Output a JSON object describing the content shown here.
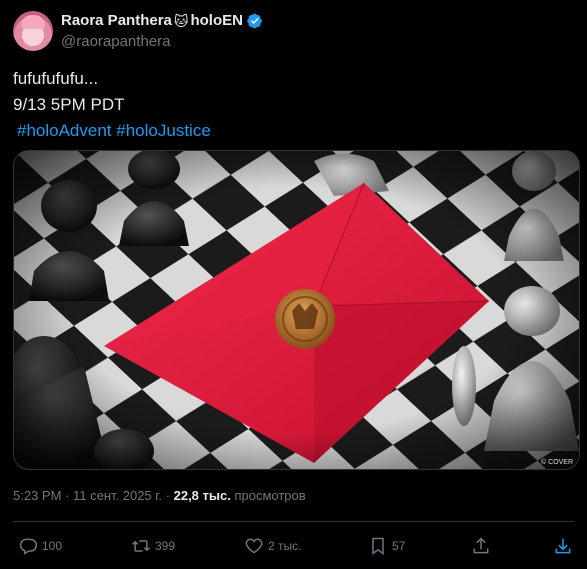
{
  "author": {
    "display_name": "Raora Panthera",
    "cat_emoji": "🐱",
    "suffix": "holoEN",
    "handle": "@raorapanthera",
    "verified_color": "#1d9bf0"
  },
  "tweet": {
    "lines": [
      "fufufufufu...",
      "9/13 5PM PDT"
    ],
    "hashtags": [
      "#holoAdvent",
      "#holoJustice"
    ],
    "hashtag_color": "#1d9bf0"
  },
  "media": {
    "watermark": "© COVER",
    "envelope_color": "#e01a3e",
    "seal_color": "#b8772e"
  },
  "meta": {
    "time": "5:23 PM",
    "separator": " · ",
    "date": "11 сент. 2025 г.",
    "views_count": "22,8 тыс.",
    "views_label": "просмотров"
  },
  "actions": {
    "replies": "100",
    "reposts": "399",
    "likes": "2 тыс.",
    "bookmarks": "57"
  }
}
